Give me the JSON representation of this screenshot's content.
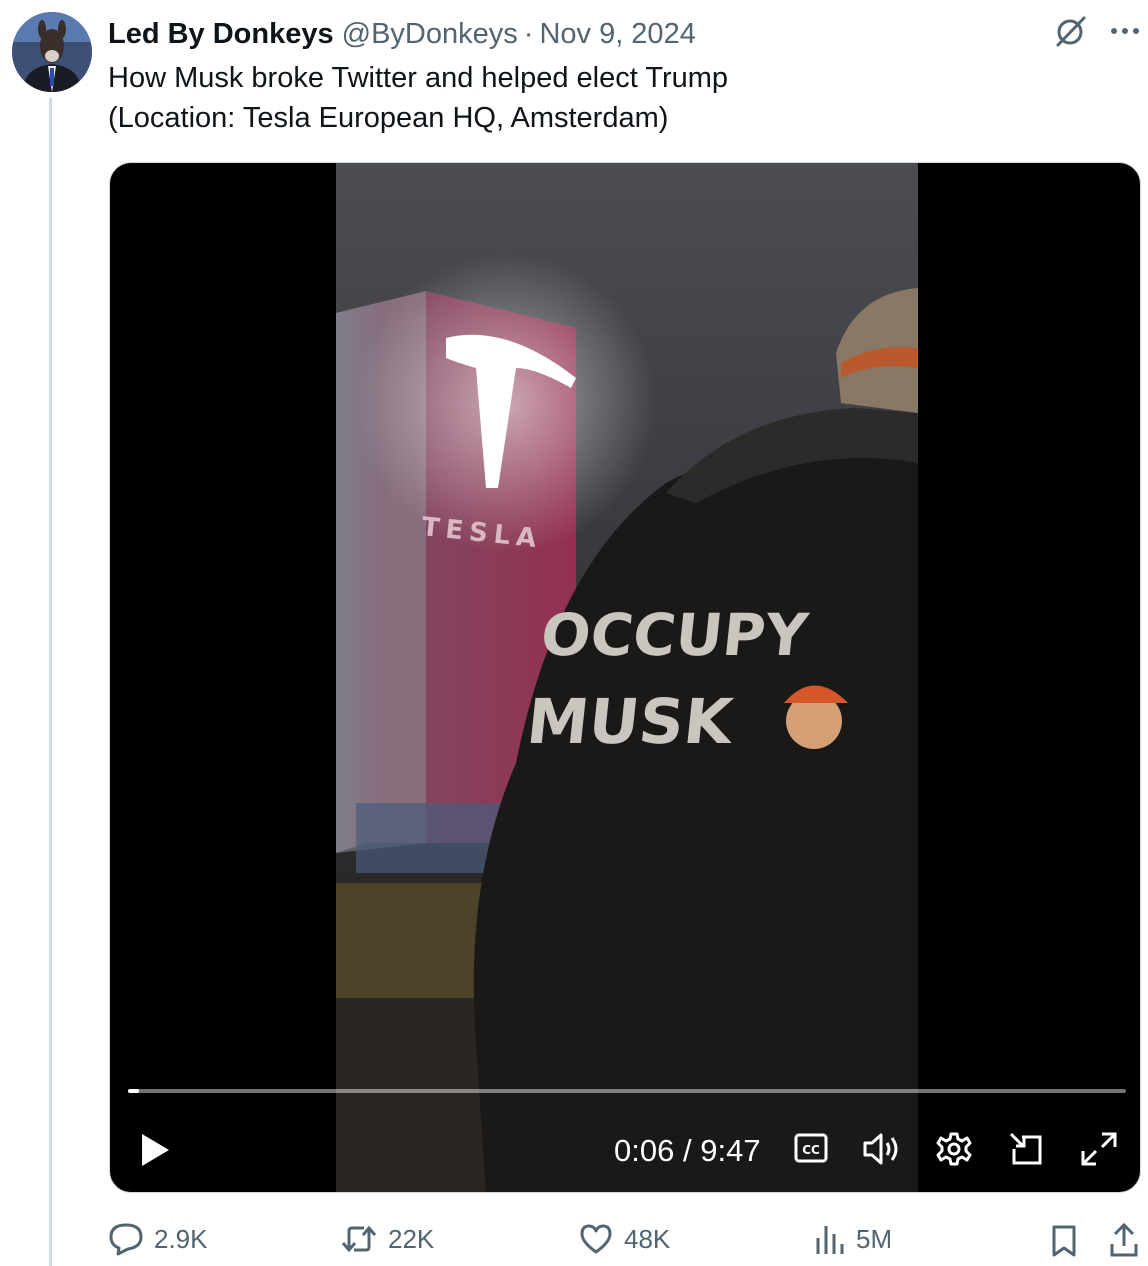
{
  "author": {
    "name": "Led By Donkeys",
    "handle": "@ByDonkeys",
    "separator": "·",
    "date": "Nov 9, 2024"
  },
  "tweet": {
    "lines": [
      "How Musk broke Twitter and helped elect Trump",
      "(Location: Tesla European HQ, Amsterdam)"
    ]
  },
  "video": {
    "jacket_text_1": "OCCUPY",
    "jacket_text_2": "MUSK",
    "sign_text": "TESLA",
    "current_time": "0:06",
    "time_separator": "/",
    "duration": "9:47",
    "progress": 0.011,
    "cc_label": "CC"
  },
  "actions": {
    "replies": "2.9K",
    "reposts": "22K",
    "likes": "48K",
    "views": "5M"
  },
  "colors": {
    "text": "#0f1419",
    "secondary": "#536471",
    "border": "#cfd9de",
    "tesla_red": "#8e2a4a"
  },
  "icons": [
    "grok-icon",
    "more-icon",
    "play-icon",
    "captions-icon",
    "volume-icon",
    "settings-icon",
    "pip-icon",
    "fullscreen-icon",
    "reply-icon",
    "repost-icon",
    "like-icon",
    "views-icon",
    "bookmark-icon",
    "share-icon"
  ]
}
